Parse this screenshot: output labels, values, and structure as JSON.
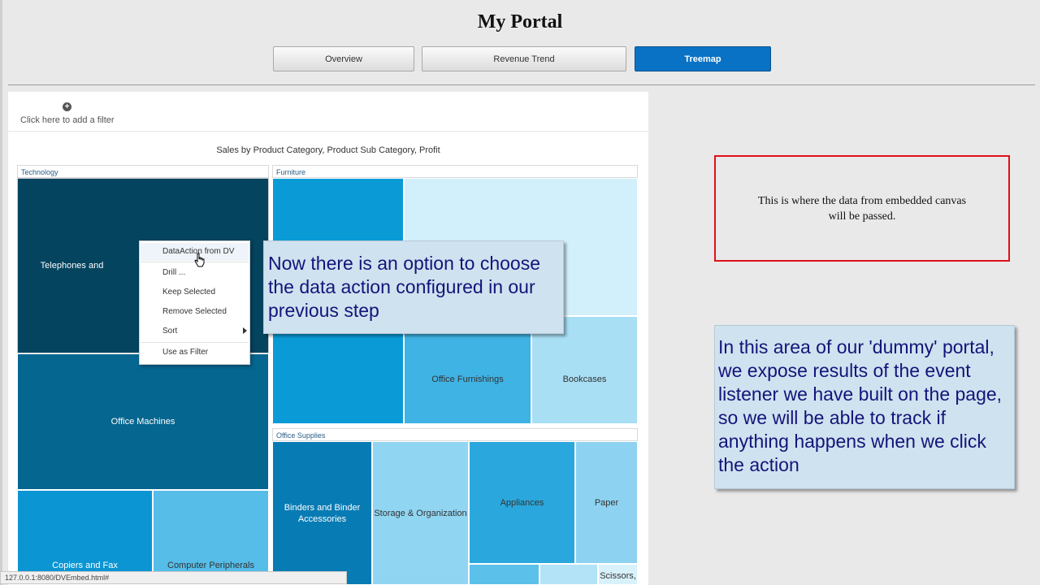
{
  "header": {
    "title": "My Portal"
  },
  "tabs": [
    {
      "label": "Overview"
    },
    {
      "label": "Revenue Trend"
    },
    {
      "label": "Treemap"
    }
  ],
  "filter": {
    "label": "Click here to add a filter"
  },
  "treemap": {
    "title": "Sales by Product Category, Product Sub Category, Profit",
    "groups": [
      "Technology",
      "Furniture",
      "Office Supplies"
    ],
    "cells": {
      "telephones": "Telephones and",
      "office_machines": "Office Machines",
      "copiers": "Copiers and Fax",
      "peripherals": "Computer Peripherals",
      "office_furnishings": "Office Furnishings",
      "bookcases": "Bookcases",
      "binders": "Binders and Binder Accessories",
      "storage": "Storage & Organization",
      "appliances": "Appliances",
      "paper": "Paper",
      "scissors": "Scissors,"
    }
  },
  "context_menu": {
    "items": [
      "DataAction from DV",
      "Drill ...",
      "Keep Selected",
      "Remove Selected",
      "Sort",
      "Use as Filter"
    ]
  },
  "callouts": {
    "center": "Now there is an option to choose the data action configured in our previous step",
    "right": "In this area of our 'dummy' portal, we expose results of the event listener we have built on the page, so we will be able to track if anything happens when we click the action"
  },
  "output_box": {
    "text": "This is where the data from embedded canvas will be passed."
  },
  "status_bar": {
    "url": "127.0.0.1:8080/DVEmbed.html#"
  },
  "colors": {
    "active_tab": "#0a72c4",
    "highlight_border": "#e0101a",
    "callout_text": "#14147a",
    "callout_bg": "#cfe2ef"
  }
}
